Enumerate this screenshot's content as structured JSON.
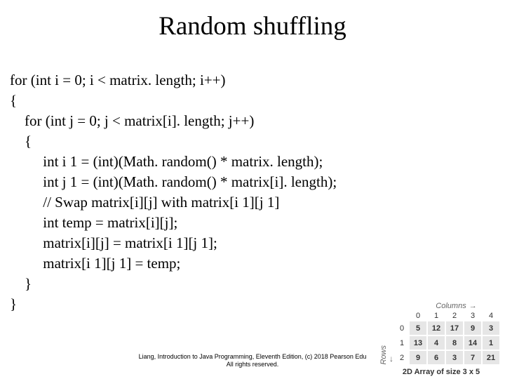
{
  "title": "Random shuffling",
  "code": {
    "l1": "for (int i = 0; i < matrix. length; i++)",
    "l2": "{",
    "l3": "    for (int j = 0; j < matrix[i]. length; j++)",
    "l4": "    {",
    "l5": "         int i 1 = (int)(Math. random() * matrix. length);",
    "l6": "         int j 1 = (int)(Math. random() * matrix[i]. length);",
    "l7": "         // Swap matrix[i][j] with matrix[i 1][j 1]",
    "l8": "         int temp = matrix[i][j];",
    "l9": "         matrix[i][j] = matrix[i 1][j 1];",
    "l10": "         matrix[i 1][j 1] = temp;",
    "l11": "    }",
    "l12": "}"
  },
  "footer": {
    "line1": "Liang, Introduction to Java Programming, Eleventh Edition, (c) 2018 Pearson Edu",
    "line2": "All rights reserved."
  },
  "fig": {
    "cols_label": "Columns",
    "rows_label": "Rows",
    "col_idx": [
      "0",
      "1",
      "2",
      "3",
      "4"
    ],
    "row_idx": [
      "0",
      "1",
      "2"
    ],
    "rows": [
      [
        "5",
        "12",
        "17",
        "9",
        "3"
      ],
      [
        "13",
        "4",
        "8",
        "14",
        "1"
      ],
      [
        "9",
        "6",
        "3",
        "7",
        "21"
      ]
    ],
    "caption": "2D Array of size 3 x 5"
  }
}
